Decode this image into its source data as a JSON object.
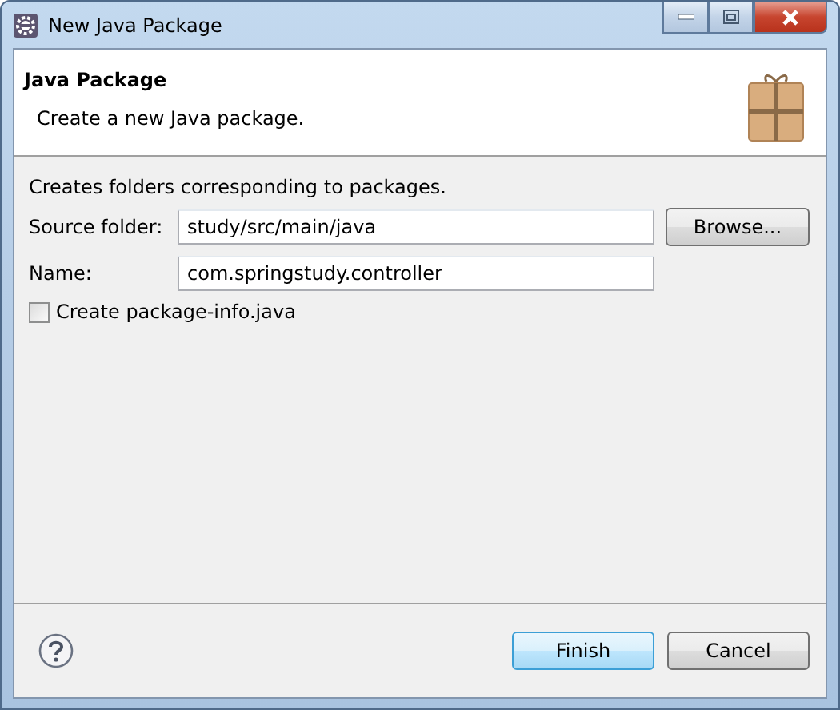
{
  "window": {
    "title": "New Java Package"
  },
  "header": {
    "title": "Java Package",
    "description": "Create a new Java package."
  },
  "intro": "Creates folders corresponding to packages.",
  "fields": [
    {
      "label": "Source folder:",
      "value": "study/src/main/java",
      "button": "Browse..."
    },
    {
      "label": "Name:",
      "value": "com.springstudy.controller"
    }
  ],
  "checkbox": {
    "label": "Create package-info.java",
    "checked": false
  },
  "buttons": [
    {
      "label": "Finish",
      "default": true
    },
    {
      "label": "Cancel",
      "default": false
    }
  ]
}
